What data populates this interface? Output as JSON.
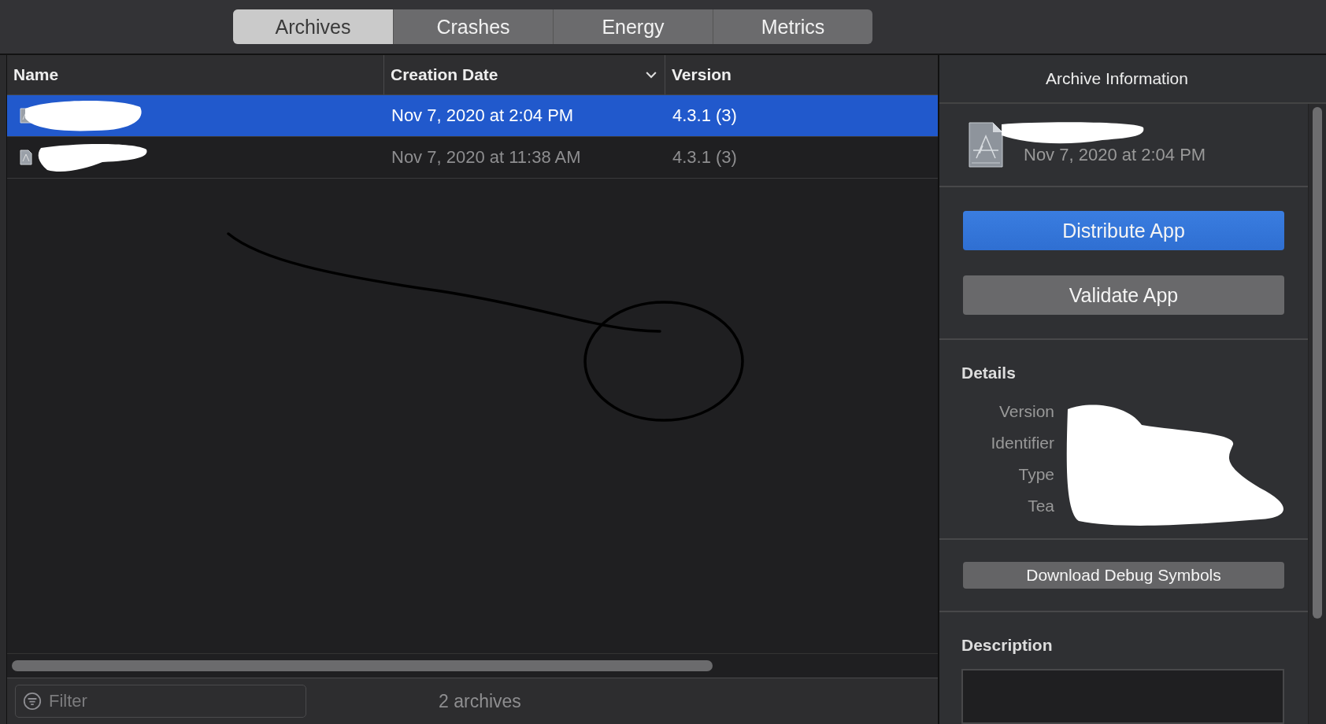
{
  "tabs": [
    {
      "label": "Archives",
      "selected": true
    },
    {
      "label": "Crashes",
      "selected": false
    },
    {
      "label": "Energy",
      "selected": false
    },
    {
      "label": "Metrics",
      "selected": false
    }
  ],
  "table": {
    "columns": [
      {
        "label": "Name",
        "sorted": false
      },
      {
        "label": "Creation Date",
        "sorted": true
      },
      {
        "label": "Version",
        "sorted": false
      }
    ],
    "rows": [
      {
        "creation_date": "Nov 7, 2020 at 2:04 PM",
        "version": "4.3.1 (3)",
        "selected": true
      },
      {
        "creation_date": "Nov 7, 2020 at 11:38 AM",
        "version": "4.3.1 (3)",
        "selected": false
      }
    ]
  },
  "filter": {
    "placeholder": "Filter"
  },
  "status": "2 archives",
  "inspector": {
    "title": "Archive Information",
    "archive_date": "Nov 7, 2020 at 2:04 PM",
    "actions": [
      {
        "label": "Distribute App",
        "kind": "primary"
      },
      {
        "label": "Validate App",
        "kind": "secondary"
      }
    ],
    "details_heading": "Details",
    "detail_labels": [
      "Version",
      "Identifier",
      "Type",
      "Tea"
    ],
    "debug_button": "Download Debug Symbols",
    "description_heading": "Description"
  }
}
